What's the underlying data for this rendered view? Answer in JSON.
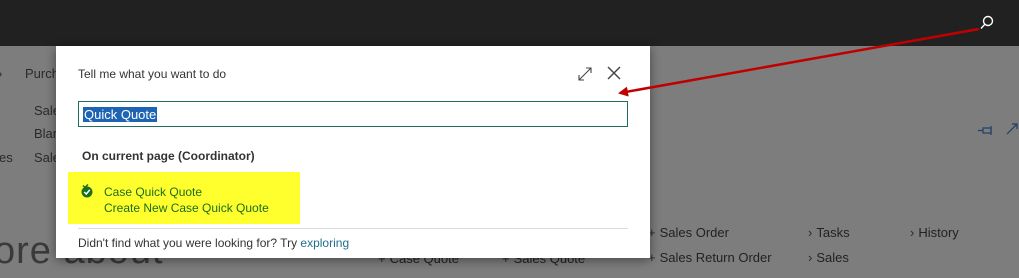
{
  "topbar": {
    "search_icon": "search-icon"
  },
  "background": {
    "nav_partial": "Purch",
    "left_edge": "es",
    "column1": [
      "Sale",
      "Blan",
      "Sale"
    ],
    "big_heading_partial": "ore about",
    "links_row_a": [
      "Sales Order",
      "Sales Return Order"
    ],
    "links_row_b": [
      "Tasks",
      "Sales"
    ],
    "links_row_c": [
      "History"
    ],
    "links_bottom": [
      "Case Quote",
      "Sales Quote"
    ],
    "pin_icon": "pin-icon",
    "expand_icon": "expand-icon"
  },
  "dialog": {
    "title": "Tell me what you want to do",
    "search_value": "Quick Quote",
    "section": "On current page (Coordinator)",
    "result": {
      "title": "Case Quick Quote",
      "subtitle": "Create New Case Quick Quote",
      "icon": "task-check-icon"
    },
    "footer_text": "Didn't find what you were looking for? Try",
    "footer_link": "exploring",
    "expand_icon": "expand-icon",
    "close_icon": "close-icon"
  },
  "annotation": {
    "arrow_color": "#c00000"
  }
}
